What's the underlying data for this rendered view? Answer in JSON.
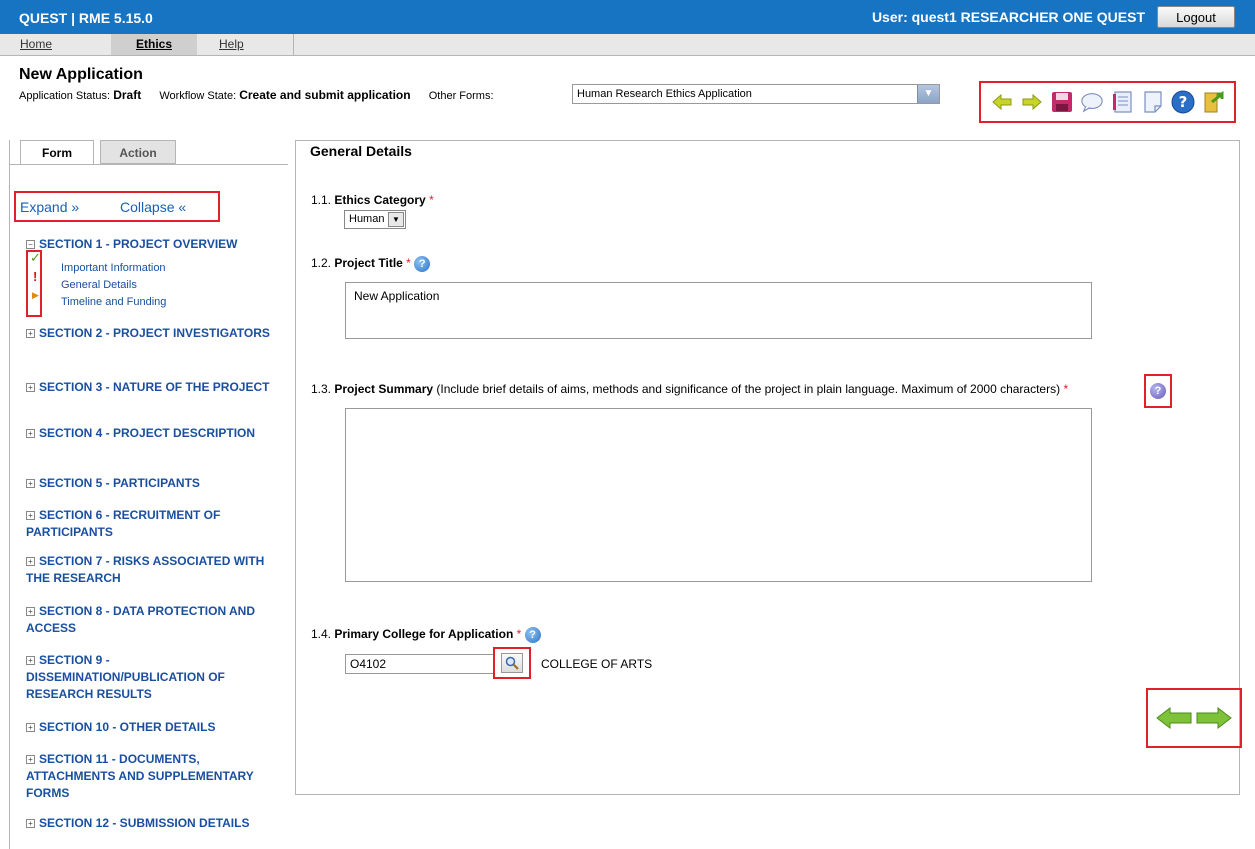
{
  "header": {
    "app_title": "QUEST | RME 5.15.0",
    "user_text": "User: quest1 RESEARCHER ONE QUEST",
    "logout_label": "Logout"
  },
  "menu": {
    "items": [
      {
        "label": "Home"
      },
      {
        "label": "Ethics"
      },
      {
        "label": "Help"
      }
    ]
  },
  "page": {
    "title": "New Application",
    "app_status_label": "Application Status:",
    "app_status_value": "Draft",
    "workflow_label": "Workflow State:",
    "workflow_value": "Create and submit application",
    "other_forms_label": "Other Forms:",
    "other_forms_value": "Human Research Ethics Application"
  },
  "toolbar": {
    "icons": [
      "arrow-left-icon",
      "arrow-right-icon",
      "save-icon",
      "comment-icon",
      "notes-icon",
      "note-icon",
      "help-icon",
      "exit-icon"
    ]
  },
  "left_panel": {
    "tabs": [
      {
        "label": "Form"
      },
      {
        "label": "Action"
      }
    ],
    "expand_label": "Expand »",
    "collapse_label": "Collapse «",
    "sections": [
      {
        "label": "SECTION 1 - PROJECT OVERVIEW"
      },
      {
        "label": "SECTION 2 - PROJECT INVESTIGATORS"
      },
      {
        "label": "SECTION 3 - NATURE OF THE PROJECT"
      },
      {
        "label": "SECTION 4 - PROJECT DESCRIPTION"
      },
      {
        "label": "SECTION 5 - PARTICIPANTS"
      },
      {
        "label": "SECTION 6 - RECRUITMENT OF PARTICIPANTS"
      },
      {
        "label": "SECTION 7 - RISKS ASSOCIATED WITH THE RESEARCH"
      },
      {
        "label": "SECTION 8 - DATA PROTECTION AND ACCESS"
      },
      {
        "label": "SECTION 9 - DISSEMINATION/PUBLICATION OF RESEARCH RESULTS"
      },
      {
        "label": "SECTION 10 - OTHER DETAILS"
      },
      {
        "label": "SECTION 11 - DOCUMENTS, ATTACHMENTS AND SUPPLEMENTARY FORMS"
      },
      {
        "label": "SECTION 12 - SUBMISSION DETAILS"
      }
    ],
    "section1_items": [
      {
        "label": "Important Information",
        "status": "complete",
        "mark": "✓",
        "color": "#4a9a1a"
      },
      {
        "label": "General Details",
        "status": "error",
        "mark": "!",
        "color": "#d01a1a"
      },
      {
        "label": "Timeline and Funding",
        "status": "current",
        "mark": "▶",
        "color": "#e08a10"
      }
    ]
  },
  "form": {
    "title": "General Details",
    "q1": {
      "number": "1.1.",
      "label": "Ethics Category",
      "required": "*",
      "value": "Human"
    },
    "q2": {
      "number": "1.2.",
      "label": "Project Title",
      "required": "*",
      "value": "New Application"
    },
    "q3": {
      "number": "1.3.",
      "label": "Project Summary",
      "note": "(Include brief details of aims, methods and significance of the project in plain language. Maximum of 2000 characters)",
      "required": "*",
      "value": ""
    },
    "q4": {
      "number": "1.4.",
      "label": "Primary College for Application",
      "required": "*",
      "code": "O4102",
      "college": "COLLEGE OF ARTS"
    },
    "help_glyph": "?"
  },
  "colors": {
    "header_bg": "#1674c3",
    "highlight_border": "#e0202a",
    "link": "#1a4fa0"
  }
}
